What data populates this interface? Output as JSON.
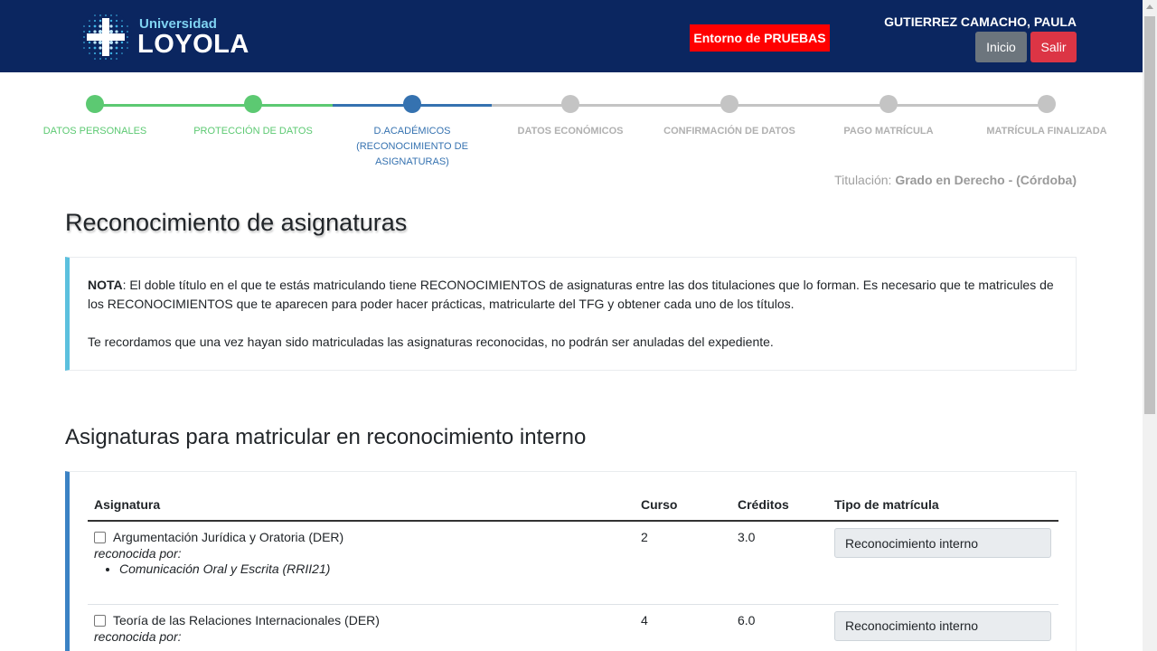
{
  "header": {
    "logo_small": "Universidad",
    "logo_big": "LOYOLA",
    "env_badge": "Entorno de PRUEBAS",
    "user_name": "GUTIERREZ CAMACHO, PAULA",
    "inicio_label": "Inicio",
    "salir_label": "Salir",
    "colors": {
      "bar": "#0b2660",
      "env": "#ff0000",
      "inicio": "#6c757d",
      "salir": "#dc3545"
    }
  },
  "stepper": {
    "steps": [
      {
        "label": "DATOS PERSONALES",
        "state": "done"
      },
      {
        "label": "PROTECCIÓN DE DATOS",
        "state": "done"
      },
      {
        "label": "D.ACADÉMICOS (RECONOCIMIENTO DE ASIGNATURAS)",
        "state": "current"
      },
      {
        "label": "DATOS ECONÓMICOS",
        "state": "todo"
      },
      {
        "label": "CONFIRMACIÓN DE DATOS",
        "state": "todo"
      },
      {
        "label": "PAGO MATRÍCULA",
        "state": "todo"
      },
      {
        "label": "MATRÍCULA FINALIZADA",
        "state": "todo"
      }
    ],
    "colors": {
      "done": "#5cc972",
      "current": "#3572b0",
      "todo": "#c4c4c4"
    }
  },
  "titulacion": {
    "label": "Titulación:",
    "value": "Grado en Derecho - (Córdoba)"
  },
  "page_title": "Reconocimiento de asignaturas",
  "note": {
    "bold": "NOTA",
    "text1": ": El doble título en el que te estás matriculando tiene RECONOCIMIENTOS de asignaturas entre las dos titulaciones que lo forman. Es necesario que te matricules de los RECONOCIMIENTOS que te aparecen para poder hacer prácticas, matricularte del TFG y obtener cada uno de los títulos.",
    "text2": "Te recordamos que una vez hayan sido matriculadas las asignaturas reconocidas, no podrán ser anuladas del expediente."
  },
  "section_title": "Asignaturas para matricular en reconocimiento interno",
  "table": {
    "headers": [
      "Asignatura",
      "Curso",
      "Créditos",
      "Tipo de matrícula"
    ],
    "recon_by_label": "reconocida por:",
    "rows": [
      {
        "asignatura": "Argumentación Jurídica y Oratoria (DER)",
        "reconocida": [
          "Comunicación Oral y Escrita (RRII21)"
        ],
        "curso": "2",
        "creditos": "3.0",
        "tipo": "Reconocimiento interno"
      },
      {
        "asignatura": "Teoría de las Relaciones Internacionales (DER)",
        "reconocida": [],
        "curso": "4",
        "creditos": "6.0",
        "tipo": "Reconocimiento interno"
      }
    ]
  }
}
